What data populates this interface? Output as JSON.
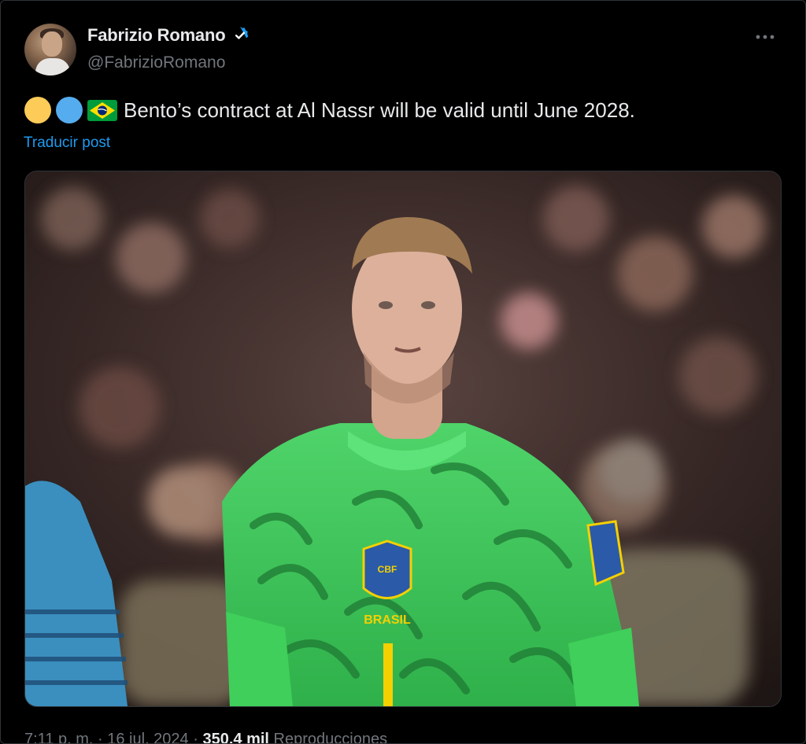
{
  "author": {
    "display_name": "Fabrizio Romano",
    "handle": "@FabrizioRomano",
    "verified": true,
    "avatar_icon": "profile-photo"
  },
  "tweet": {
    "emojis": [
      "yellow-circle",
      "blue-circle",
      "brazil-flag"
    ],
    "text": "Bento’s contract at Al Nassr will be valid until June 2028.",
    "translate_label": "Traducir post",
    "media_description_icon": "goalkeeper-photo"
  },
  "meta": {
    "time": "7:11 p. m.",
    "separator": "·",
    "date": "16 jul. 2024",
    "views_count": "350,4 mil",
    "views_label": "Reproducciones"
  },
  "colors": {
    "background": "#000000",
    "primary_text": "#e7e9ea",
    "secondary_text": "#71767b",
    "link": "#1d9bf0",
    "verified": "#1d9bf0"
  }
}
